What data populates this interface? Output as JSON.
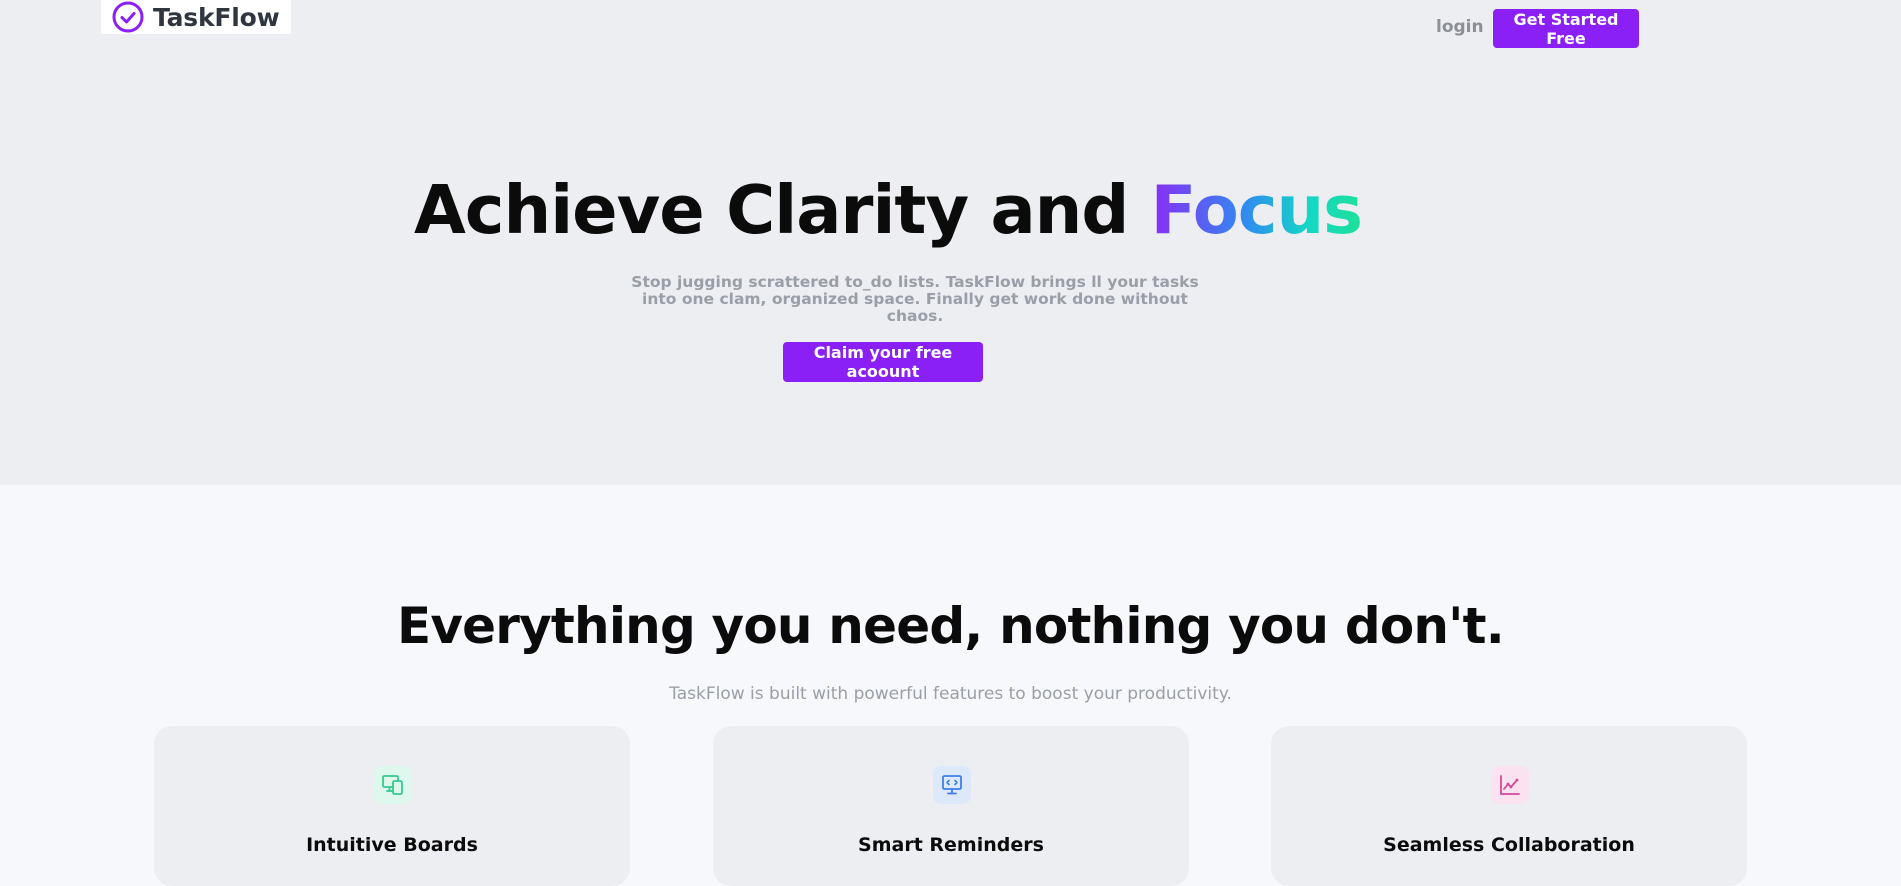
{
  "brand": {
    "name": "TaskFlow",
    "logo_icon": "check-circle-icon",
    "accent_color": "#8a1ff6"
  },
  "nav": {
    "login_label": "login",
    "cta_label": "Get Started Free"
  },
  "hero": {
    "title_main": "Achieve Clarity and",
    "title_highlight": "Focus",
    "subtitle": "Stop jugging scrattered to_do lists. TaskFlow brings ll your tasks into one clam, organized space. Finally get work done without chaos.",
    "cta_label": "Claim your free acoount"
  },
  "features": {
    "title": "Everything you need, nothing you don't.",
    "subtitle": "TaskFlow is built with powerful features to boost your productivity.",
    "items": [
      {
        "title": "Intuitive Boards",
        "icon": "boards-icon",
        "icon_color": "#34c98f"
      },
      {
        "title": "Smart Reminders",
        "icon": "reminder-monitor-icon",
        "icon_color": "#3f7fe3"
      },
      {
        "title": "Seamless Collaboration",
        "icon": "chart-line-icon",
        "icon_color": "#d24a9a"
      }
    ]
  }
}
